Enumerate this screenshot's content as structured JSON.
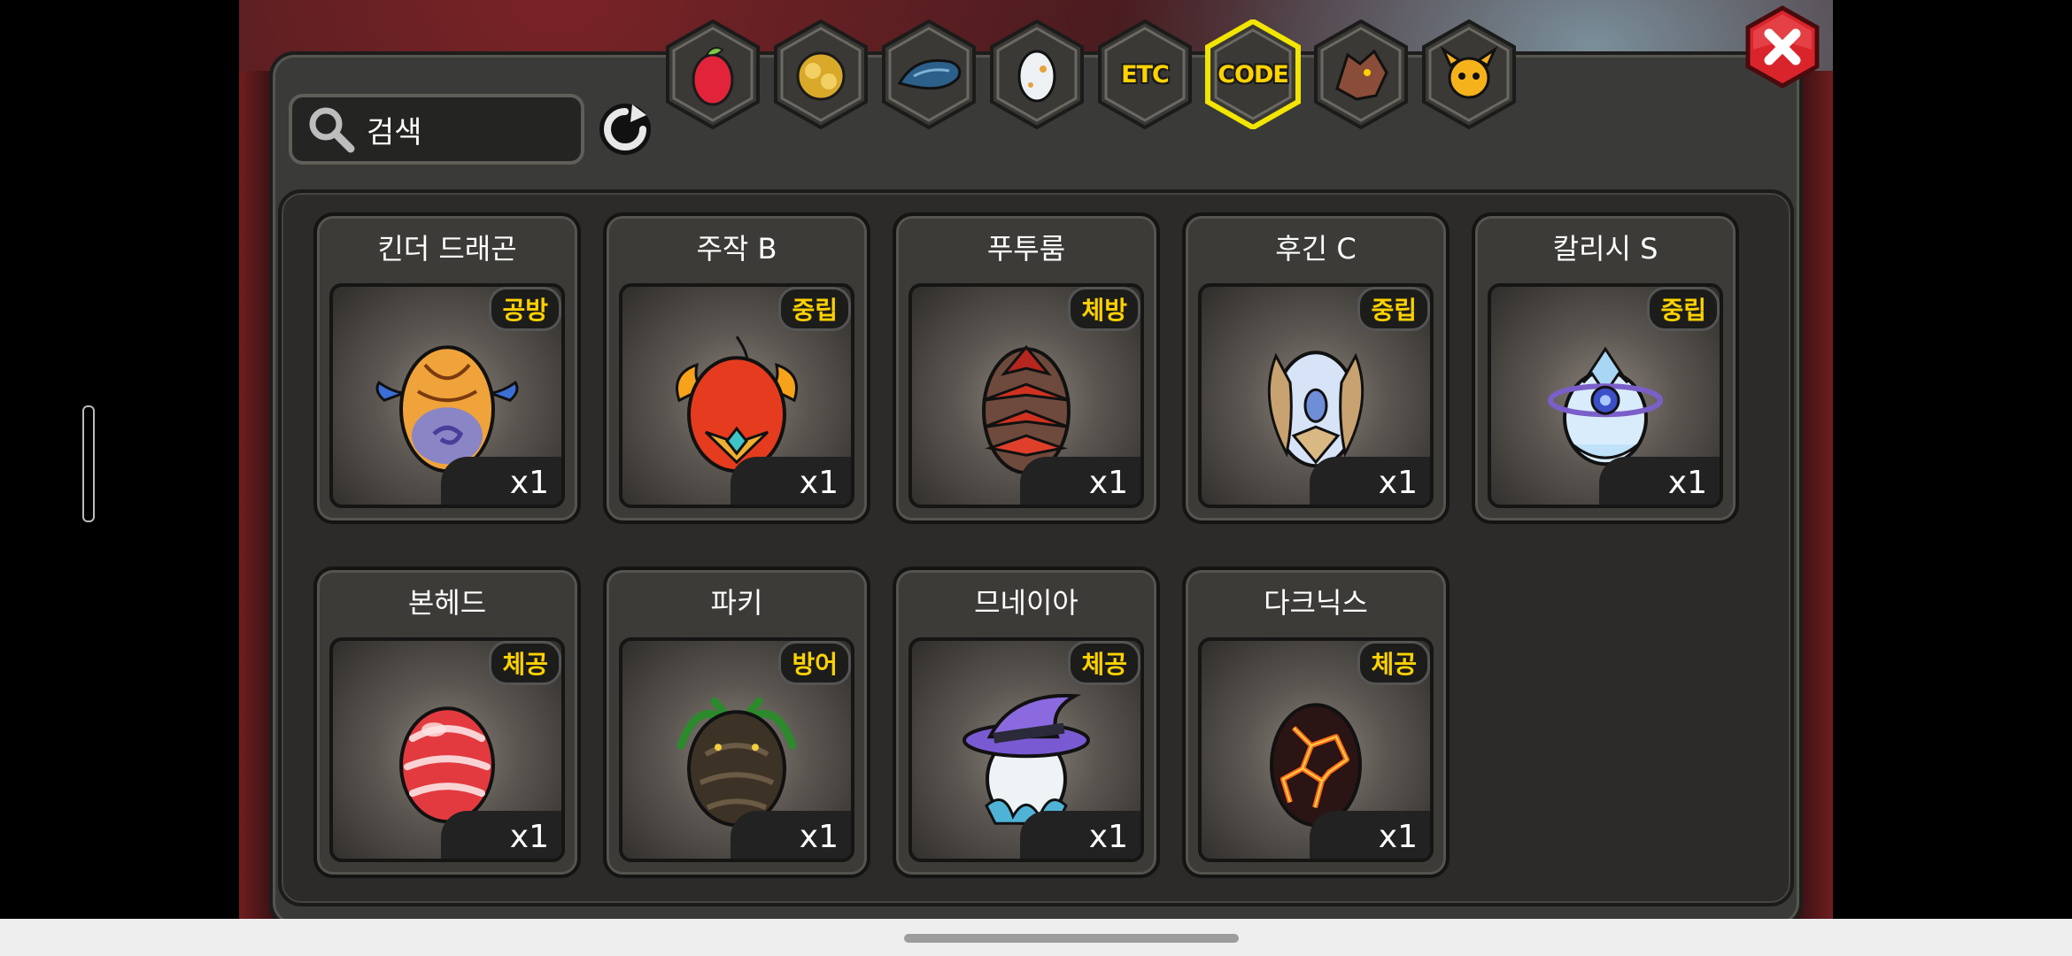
{
  "search": {
    "value": "검색"
  },
  "tabs": [
    {
      "name": "fruit-tab",
      "label": "",
      "icon": "fruit-icon",
      "selected": false
    },
    {
      "name": "coin-tab",
      "label": "",
      "icon": "gold-coins-icon",
      "selected": false
    },
    {
      "name": "scale-tab",
      "label": "",
      "icon": "blue-scale-icon",
      "selected": false
    },
    {
      "name": "egg-tab",
      "label": "",
      "icon": "egg-icon",
      "selected": false
    },
    {
      "name": "etc-tab",
      "label": "ETC",
      "icon": "",
      "selected": false
    },
    {
      "name": "code-tab",
      "label": "CODE",
      "icon": "",
      "selected": true
    },
    {
      "name": "dragon-tab",
      "label": "",
      "icon": "dragon-head-icon",
      "selected": false
    },
    {
      "name": "mascot-tab",
      "label": "",
      "icon": "horned-mascot-icon",
      "selected": false
    }
  ],
  "items": [
    {
      "name": "킨더 드래곤",
      "badge": "공방",
      "qty": "x1",
      "egg": "orange-flame-egg-icon"
    },
    {
      "name": "주작 B",
      "badge": "중립",
      "qty": "x1",
      "egg": "fire-phoenix-egg-icon"
    },
    {
      "name": "푸투룸",
      "badge": "체방",
      "qty": "x1",
      "egg": "spiked-red-egg-icon"
    },
    {
      "name": "후긴 C",
      "badge": "중립",
      "qty": "x1",
      "egg": "winged-white-egg-icon"
    },
    {
      "name": "칼리시 S",
      "badge": "중립",
      "qty": "x1",
      "egg": "ice-crystal-egg-icon"
    },
    {
      "name": "본헤드",
      "badge": "체공",
      "qty": "x1",
      "egg": "red-bone-egg-icon"
    },
    {
      "name": "파키",
      "badge": "방어",
      "qty": "x1",
      "egg": "feathered-dark-egg-icon"
    },
    {
      "name": "므네이아",
      "badge": "체공",
      "qty": "x1",
      "egg": "witch-hat-egg-icon"
    },
    {
      "name": "다크닉스",
      "badge": "체공",
      "qty": "x1",
      "egg": "lava-crack-egg-icon"
    }
  ],
  "colors": {
    "accent": "#ffd200",
    "close": "#d9242b",
    "panel": "#3a3a38"
  }
}
